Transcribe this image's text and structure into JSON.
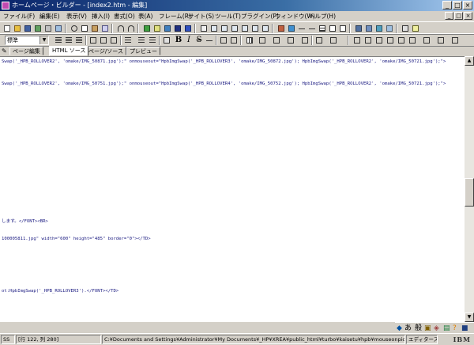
{
  "window": {
    "title": "ホームページ・ビルダー - [index2.htm - 編集]",
    "buttons": {
      "minimize": "_",
      "maximize": "□",
      "close": "×"
    }
  },
  "menu": {
    "items": [
      "ファイル(F)",
      "編集(E)",
      "表示(V)",
      "挿入(I)",
      "書式(O)",
      "表(A)",
      "フレーム(R)",
      "サイト(S)",
      "ツール(T)",
      "プラグイン(P)",
      "ウィンドウ(W)",
      "ヘルプ(H)"
    ]
  },
  "toolbar2": {
    "style_combo": "標準",
    "bold": "B",
    "italic": "I",
    "strike": "S"
  },
  "tabs": {
    "items": [
      "ページ編集",
      "HTML ソース",
      "ページ/ソース",
      "プレビュー"
    ],
    "active_index": 1
  },
  "editor": {
    "lines": [
      "Swap('_HPB_ROLLOVER2', 'omake/IMG_50871.jpg');\" onmouseout=\"HpbImgSwap('_HPB_ROLLOVER3', 'omake/IMG_50872.jpg'); HpbImgSwap('_HPB_ROLLOVER2', 'omake/IMG_50721.jpg');\">",
      "Swap('_HPB_ROLLOVER2', 'omake/IMG_50751.jpg');\" onmouseout=\"HpbImgSwap('_HPB_ROLLOVER4', 'omake/IMG_50752.jpg'); HpbImgSwap('_HPB_ROLLOVER2', 'omake/IMG_50721.jpg');\">",
      "します。</FONT><BR>",
      "100005811.jpg\" width=\"600\" height=\"485\" border=\"0\"></TD>",
      "ot:HpbImgSwap('_HPB_ROLLOVER3').</FONT></TD>"
    ]
  },
  "ime": {
    "mode": "あ",
    "ime_label": "般"
  },
  "status": {
    "mode": "SS",
    "position": "[行 122, 列 280]",
    "path": "C:¥Documents and Settings¥Administrator¥My Documents¥_HP¥XREA¥public_html¥turbo¥kaisetu¥hpb¥mouseonpic¥index2.htm",
    "editor_label": "エディターズ",
    "brand": "IBM"
  }
}
